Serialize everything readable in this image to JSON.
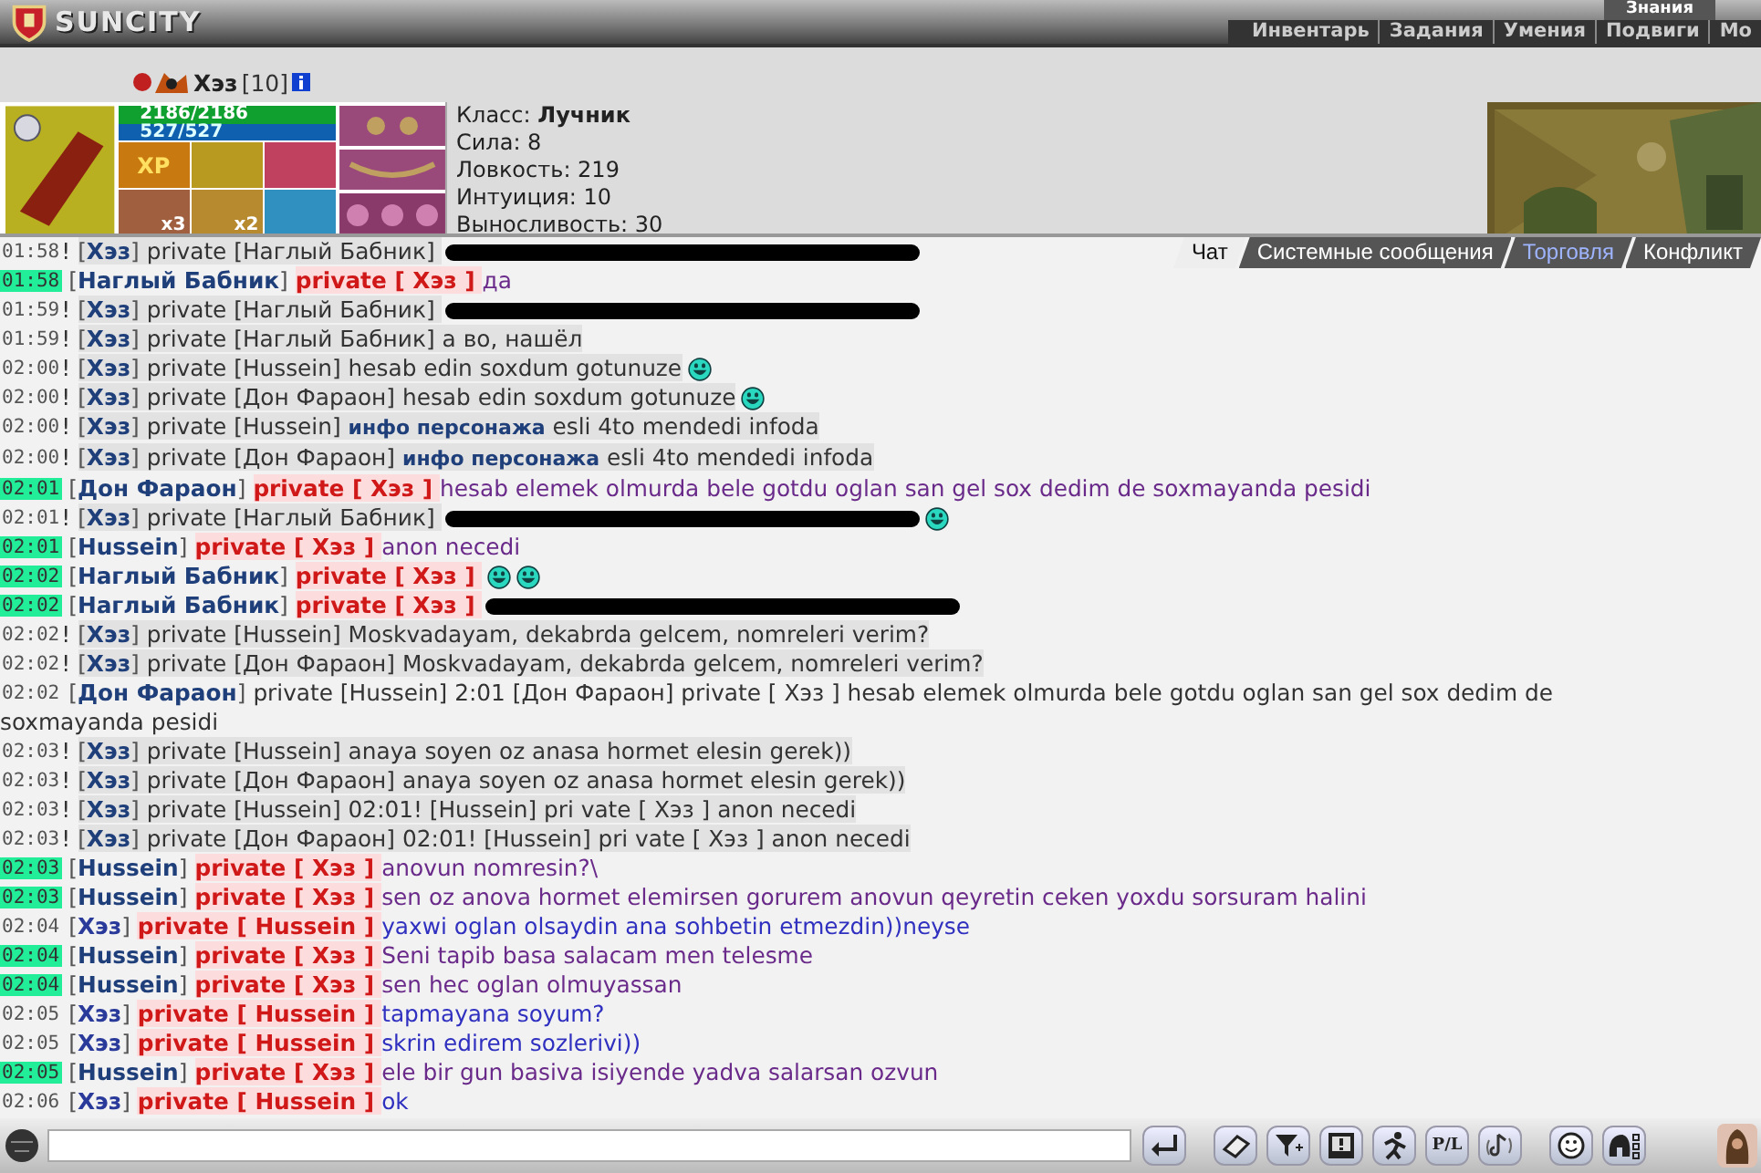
{
  "header": {
    "logo": "SUNCITY",
    "top_tab": "Знания",
    "nav": [
      "Инвентарь",
      "Задания",
      "Умения",
      "Подвиги",
      "Мо"
    ]
  },
  "character": {
    "name": "Хэз",
    "level": "[10]",
    "hp": "2186/2186",
    "mana": "527/527",
    "quick_slots": [
      {
        "kind": "xp",
        "label": "XP"
      },
      {
        "kind": "scroll"
      },
      {
        "kind": "orb"
      },
      {
        "kind": "owl",
        "count": "x3"
      },
      {
        "kind": "food",
        "count": "x2"
      },
      {
        "kind": "bottle"
      }
    ],
    "stats": [
      "Класс: **Лучник**",
      "Сила: 8",
      "Ловкость: 219",
      "Интуиция: 10",
      "Выносливость: 30"
    ]
  },
  "chat_tabs": [
    {
      "label": "Чат",
      "selected": true,
      "unread": false
    },
    {
      "label": "Системные сообщения",
      "selected": false,
      "unread": false
    },
    {
      "label": "Торговля",
      "selected": false,
      "unread": true
    },
    {
      "label": "Конфликт",
      "selected": false,
      "unread": false
    }
  ],
  "messages": [
    {
      "time": "01:58",
      "new": false,
      "mark": "!",
      "kind": "out",
      "sender": "[**Хэз**]",
      "target": "private [Наглый Бабник]",
      "redacted": true
    },
    {
      "time": "01:58",
      "new": true,
      "kind": "in",
      "sender": "[**Наглый Бабник**]",
      "target": "private [ Хэз ]",
      "text": "да"
    },
    {
      "time": "01:59",
      "new": false,
      "mark": "!",
      "kind": "out",
      "sender": "[**Хэз**]",
      "target": "private [Наглый Бабник]",
      "redacted": true
    },
    {
      "time": "01:59",
      "new": false,
      "mark": "!",
      "kind": "out",
      "sender": "[**Хэз**]",
      "target": "private [Наглый Бабник]",
      "text": "а во, нашёл"
    },
    {
      "time": "02:00",
      "new": false,
      "mark": "!",
      "kind": "out",
      "sender": "[**Хэз**]",
      "target": "private [Hussein]",
      "text": "hesab edin soxdum gotunuze",
      "emoticons": [
        {
          "kind": "grin"
        }
      ]
    },
    {
      "time": "02:00",
      "new": false,
      "mark": "!",
      "kind": "out",
      "sender": "[**Хэз**]",
      "target": "private [Дон Фараон]",
      "text": "hesab edin soxdum gotunuze",
      "emoticons": [
        {
          "kind": "grin"
        }
      ]
    },
    {
      "time": "02:00",
      "new": false,
      "mark": "!",
      "kind": "out",
      "sender": "[**Хэз**]",
      "target": "private [Hussein]",
      "text": "**инфо персонажа** esli 4to mendedi infoda"
    },
    {
      "time": "02:00",
      "new": false,
      "mark": "!",
      "kind": "out",
      "sender": "[**Хэз**]",
      "target": "private [Дон Фараон]",
      "text": "**инфо персонажа** esli 4to mendedi infoda"
    },
    {
      "time": "02:01",
      "new": true,
      "kind": "in",
      "sender": "[**Дон Фараон**]",
      "target": "private [ Хэз ]",
      "text": "hesab elemek olmurda bele gotdu oglan san gel sox dedim de soxmayanda pesidi"
    },
    {
      "time": "02:01",
      "new": false,
      "mark": "!",
      "kind": "out",
      "sender": "[**Хэз**]",
      "target": "private [Наглый Бабник]",
      "redacted": true,
      "emoticons": [
        {
          "kind": "grin"
        }
      ]
    },
    {
      "time": "02:01",
      "new": true,
      "kind": "in",
      "sender": "[**Hussein**]",
      "target": "private [ Хэз ]",
      "text": "anon necedi"
    },
    {
      "time": "02:02",
      "new": true,
      "kind": "in",
      "sender": "[**Наглый Бабник**]",
      "target": "private [ Хэз ]",
      "emoticons": [
        {
          "kind": "grin"
        },
        {
          "kind": "grin"
        }
      ]
    },
    {
      "time": "02:02",
      "new": true,
      "kind": "in",
      "sender": "[**Наглый Бабник**]",
      "target": "private [ Хэз ]",
      "redacted": true
    },
    {
      "time": "02:02",
      "new": false,
      "mark": "!",
      "kind": "out",
      "sender": "[**Хэз**]",
      "target": "private [Hussein]",
      "text": "Moskvadayam, dekabrda gelcem, nomreleri verim?"
    },
    {
      "time": "02:02",
      "new": false,
      "mark": "!",
      "kind": "out",
      "sender": "[**Хэз**]",
      "target": "private [Дон Фараон]",
      "text": "Moskvadayam, dekabrda gelcem, nomreleri verim?"
    },
    {
      "time": "02:02",
      "new": false,
      "kind": "relay",
      "sender": "[**Дон Фараон**]",
      "target": "private [Hussein]",
      "text": "2:01 [Дон Фараон] private [ Хэз ] hesab elemek olmurda bele gotdu oglan san gel sox dedim de",
      "text_wrap": "soxmayanda pesidi"
    },
    {
      "time": "02:03",
      "new": false,
      "mark": "!",
      "kind": "out",
      "sender": "[**Хэз**]",
      "target": "private [Hussein]",
      "text": "anaya soyen oz anasa hormet elesin gerek))"
    },
    {
      "time": "02:03",
      "new": false,
      "mark": "!",
      "kind": "out",
      "sender": "[**Хэз**]",
      "target": "private [Дон Фараон]",
      "text": "anaya soyen oz anasa hormet elesin gerek))"
    },
    {
      "time": "02:03",
      "new": false,
      "mark": "!",
      "kind": "out",
      "sender": "[**Хэз**]",
      "target": "private [Hussein]",
      "text": "02:01! [Hussein] pri vate [ Хэз ] anon necedi"
    },
    {
      "time": "02:03",
      "new": false,
      "mark": "!",
      "kind": "out",
      "sender": "[**Хэз**]",
      "target": "private [Дон Фараон]",
      "text": "02:01! [Hussein] pri vate [ Хэз ] anon necedi"
    },
    {
      "time": "02:03",
      "new": true,
      "kind": "in",
      "sender": "[**Hussein**]",
      "target": "private [ Хэз ]",
      "text": "anovun nomresin?\\"
    },
    {
      "time": "02:03",
      "new": true,
      "kind": "in",
      "sender": "[**Hussein**]",
      "target": "private [ Хэз ]",
      "text": "sen oz anova hormet elemirsen gorurem anovun qeyretin ceken yoxdu sorsuram halini"
    },
    {
      "time": "02:04",
      "new": false,
      "kind": "sent",
      "sender": "[**Хэз**]",
      "target": "private [ Hussein ]",
      "text": "yaxwi oglan olsaydin ana sohbetin etmezdin))neyse"
    },
    {
      "time": "02:04",
      "new": true,
      "kind": "in",
      "sender": "[**Hussein**]",
      "target": "private [ Хэз ]",
      "text": "Seni tapib basa salacam men telesme"
    },
    {
      "time": "02:04",
      "new": true,
      "kind": "in",
      "sender": "[**Hussein**]",
      "target": "private [ Хэз ]",
      "text": "sen hec oglan olmuyassan"
    },
    {
      "time": "02:05",
      "new": false,
      "kind": "sent",
      "sender": "[**Хэз**]",
      "target": "private [ Hussein ]",
      "text": "tapmayana soyum?"
    },
    {
      "time": "02:05",
      "new": false,
      "kind": "sent",
      "sender": "[**Хэз**]",
      "target": "private [ Hussein ]",
      "text": "skrin edirem sozlerivi))"
    },
    {
      "time": "02:05",
      "new": true,
      "kind": "in",
      "sender": "[**Hussein**]",
      "target": "private [ Хэз ]",
      "text": "ele bir gun basiva isiyende yadva salarsan ozvun"
    },
    {
      "time": "02:06",
      "new": false,
      "kind": "sent",
      "sender": "[**Хэз**]",
      "target": "private [ Hussein ]",
      "text": "ok"
    }
  ],
  "toolbar": [
    {
      "kind": "enter"
    },
    {
      "kind": "eraser"
    },
    {
      "kind": "filter"
    },
    {
      "kind": "alert"
    },
    {
      "kind": "runner"
    },
    {
      "kind": "pl",
      "label": "P/L"
    },
    {
      "kind": "music"
    },
    {
      "kind": "smiley"
    },
    {
      "kind": "helmet"
    }
  ]
}
